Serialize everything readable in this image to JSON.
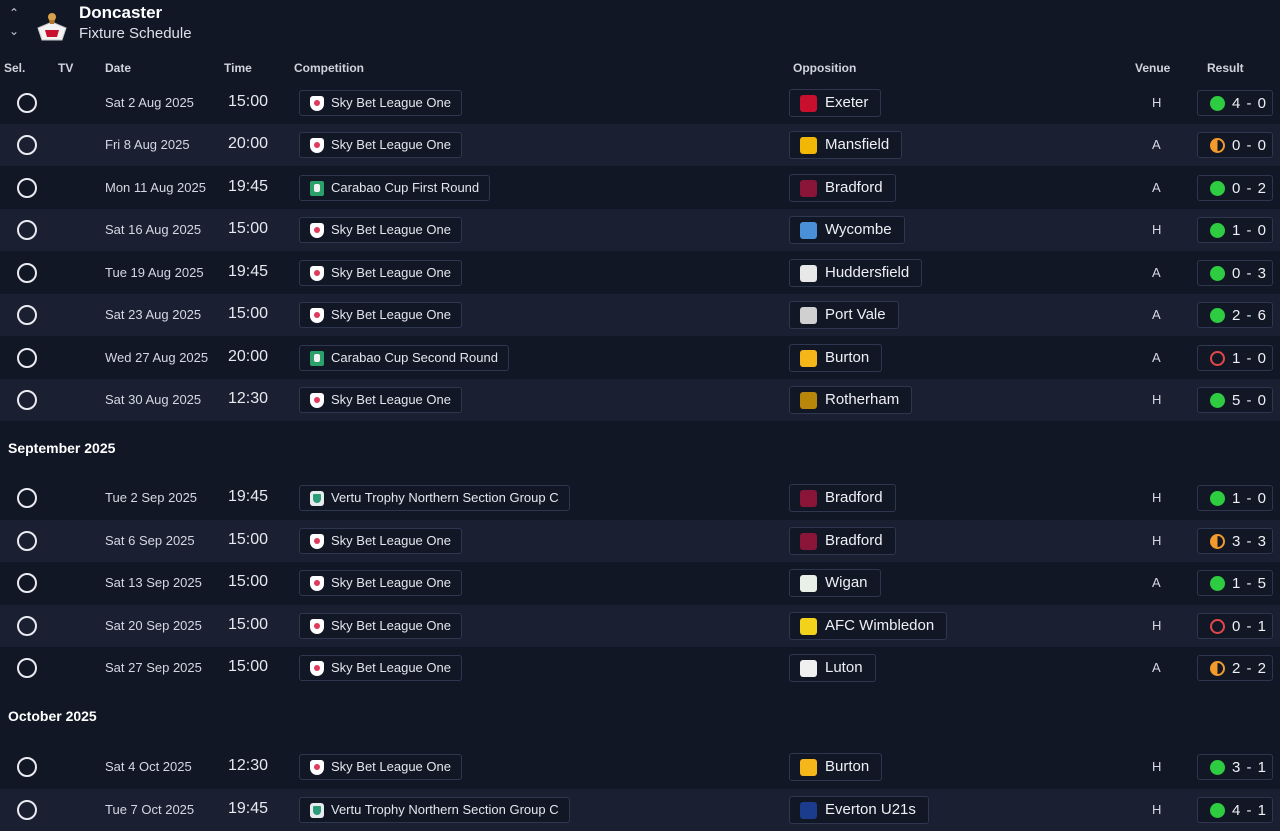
{
  "header": {
    "club_name": "Doncaster",
    "subtitle": "Fixture Schedule",
    "nav_up": "^",
    "nav_down": "⌄"
  },
  "columns": {
    "sel": "Sel.",
    "tv": "TV",
    "date": "Date",
    "time": "Time",
    "competition": "Competition",
    "opposition": "Opposition",
    "venue": "Venue",
    "result": "Result"
  },
  "months": {
    "september": "September 2025",
    "october": "October 2025"
  },
  "fixtures": [
    {
      "date": "Sat 2 Aug 2025",
      "time": "15:00",
      "competition": "Sky Bet League One",
      "comp_type": "league",
      "opposition": "Exeter",
      "crest_color": "#c8102e",
      "venue": "H",
      "outcome": "win",
      "score": "4 - 0"
    },
    {
      "date": "Fri 8 Aug 2025",
      "time": "20:00",
      "competition": "Sky Bet League One",
      "comp_type": "league",
      "opposition": "Mansfield",
      "crest_color": "#f2b705",
      "venue": "A",
      "outcome": "draw",
      "score": "0 - 0"
    },
    {
      "date": "Mon 11 Aug 2025",
      "time": "19:45",
      "competition": "Carabao Cup First Round",
      "comp_type": "cup",
      "opposition": "Bradford",
      "crest_color": "#8a1538",
      "venue": "A",
      "outcome": "win",
      "score": "0 - 2"
    },
    {
      "date": "Sat 16 Aug 2025",
      "time": "15:00",
      "competition": "Sky Bet League One",
      "comp_type": "league",
      "opposition": "Wycombe",
      "crest_color": "#4a90d9",
      "venue": "H",
      "outcome": "win",
      "score": "1 - 0"
    },
    {
      "date": "Tue 19 Aug 2025",
      "time": "19:45",
      "competition": "Sky Bet League One",
      "comp_type": "league",
      "opposition": "Huddersfield",
      "crest_color": "#e8e8e8",
      "venue": "A",
      "outcome": "win",
      "score": "0 - 3"
    },
    {
      "date": "Sat 23 Aug 2025",
      "time": "15:00",
      "competition": "Sky Bet League One",
      "comp_type": "league",
      "opposition": "Port Vale",
      "crest_color": "#d0d0d0",
      "venue": "A",
      "outcome": "win",
      "score": "2 - 6"
    },
    {
      "date": "Wed 27 Aug 2025",
      "time": "20:00",
      "competition": "Carabao Cup Second Round",
      "comp_type": "cup",
      "opposition": "Burton",
      "crest_color": "#f5b61a",
      "venue": "A",
      "outcome": "loss",
      "score": "1 - 0"
    },
    {
      "date": "Sat 30 Aug 2025",
      "time": "12:30",
      "competition": "Sky Bet League One",
      "comp_type": "league",
      "opposition": "Rotherham",
      "crest_color": "#b8860b",
      "venue": "H",
      "outcome": "win",
      "score": "5 - 0"
    },
    {
      "date": "Tue 2 Sep 2025",
      "time": "19:45",
      "competition": "Vertu Trophy Northern Section Group C",
      "comp_type": "vertu",
      "opposition": "Bradford",
      "crest_color": "#8a1538",
      "venue": "H",
      "outcome": "win",
      "score": "1 - 0"
    },
    {
      "date": "Sat 6 Sep 2025",
      "time": "15:00",
      "competition": "Sky Bet League One",
      "comp_type": "league",
      "opposition": "Bradford",
      "crest_color": "#8a1538",
      "venue": "H",
      "outcome": "draw",
      "score": "3 - 3"
    },
    {
      "date": "Sat 13 Sep 2025",
      "time": "15:00",
      "competition": "Sky Bet League One",
      "comp_type": "league",
      "opposition": "Wigan",
      "crest_color": "#e8f0e8",
      "venue": "A",
      "outcome": "win",
      "score": "1 - 5"
    },
    {
      "date": "Sat 20 Sep 2025",
      "time": "15:00",
      "competition": "Sky Bet League One",
      "comp_type": "league",
      "opposition": "AFC Wimbledon",
      "crest_color": "#f2d21b",
      "venue": "H",
      "outcome": "loss",
      "score": "0 - 1"
    },
    {
      "date": "Sat 27 Sep 2025",
      "time": "15:00",
      "competition": "Sky Bet League One",
      "comp_type": "league",
      "opposition": "Luton",
      "crest_color": "#f0f0f0",
      "venue": "A",
      "outcome": "draw",
      "score": "2 - 2"
    },
    {
      "date": "Sat 4 Oct 2025",
      "time": "12:30",
      "competition": "Sky Bet League One",
      "comp_type": "league",
      "opposition": "Burton",
      "crest_color": "#f5b61a",
      "venue": "H",
      "outcome": "win",
      "score": "3 - 1"
    },
    {
      "date": "Tue 7 Oct 2025",
      "time": "19:45",
      "competition": "Vertu Trophy Northern Section Group C",
      "comp_type": "vertu",
      "opposition": "Everton U21s",
      "crest_color": "#1b3c8c",
      "venue": "H",
      "outcome": "win",
      "score": "4 - 1"
    }
  ]
}
